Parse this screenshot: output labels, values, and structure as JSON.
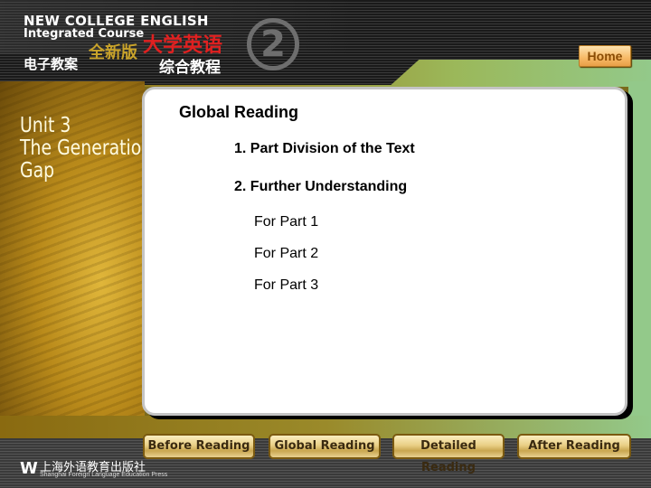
{
  "header": {
    "brand_en_line1": "NEW COLLEGE ENGLISH",
    "brand_en_line2": "Integrated Course",
    "edition_cn": "全新版",
    "title_cn": "大学英语",
    "subtitle_cn": "综合教程",
    "courseware_cn": "电子教案",
    "volume_number": "2",
    "home_label": "Home"
  },
  "unit": {
    "number_label": "Unit 3",
    "title_line1": "The Generation",
    "title_line2": "Gap"
  },
  "content": {
    "section_title": "Global Reading",
    "items": [
      {
        "label": "1. Part Division of the Text"
      },
      {
        "label": "2. Further Understanding"
      }
    ],
    "sub_items": [
      {
        "label": "For Part 1"
      },
      {
        "label": "For Part 2"
      },
      {
        "label": "For Part 3"
      }
    ]
  },
  "nav": {
    "buttons": [
      {
        "label": "Before Reading"
      },
      {
        "label": "Global Reading"
      },
      {
        "label": "Detailed Reading"
      },
      {
        "label": "After Reading"
      }
    ]
  },
  "footer": {
    "logo_glyph": "W",
    "publisher_cn": "上海外语教育出版社",
    "publisher_en": "Shanghai Foreign Language Education Press"
  },
  "colors": {
    "home_button": "#f7b966",
    "nav_button": "#e9cf85",
    "title_red": "#e02020",
    "edition_gold": "#c9a32a"
  }
}
